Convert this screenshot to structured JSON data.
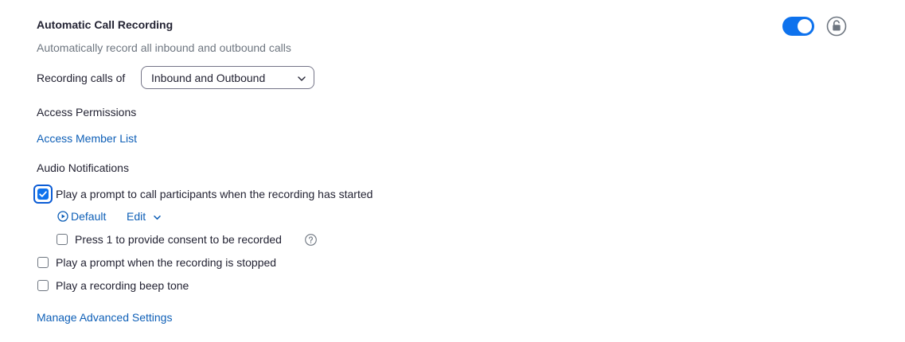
{
  "setting": {
    "title": "Automatic Call Recording",
    "description": "Automatically record all inbound and outbound calls",
    "enabled": true
  },
  "recording": {
    "label": "Recording calls of",
    "selected": "Inbound and Outbound"
  },
  "access": {
    "heading": "Access Permissions",
    "member_list_link": "Access Member List"
  },
  "audio": {
    "heading": "Audio Notifications",
    "prompt_started": {
      "label": "Play a prompt to call participants when the recording has started",
      "checked": true
    },
    "default_link": "Default",
    "edit_link": "Edit",
    "consent": {
      "label": "Press 1 to provide consent to be recorded",
      "checked": false
    },
    "prompt_stopped": {
      "label": "Play a prompt when the recording is stopped",
      "checked": false
    },
    "beep_tone": {
      "label": "Play a recording beep tone",
      "checked": false
    }
  },
  "advanced_link": "Manage Advanced Settings",
  "colors": {
    "accent": "#0e72ed",
    "link": "#0b5cd5",
    "muted_text": "#6e7680"
  },
  "icons": {
    "lock": "lock-icon",
    "chevron": "chevron-down-icon",
    "play": "play-circle-icon",
    "help": "help-icon",
    "check": "check-icon"
  }
}
